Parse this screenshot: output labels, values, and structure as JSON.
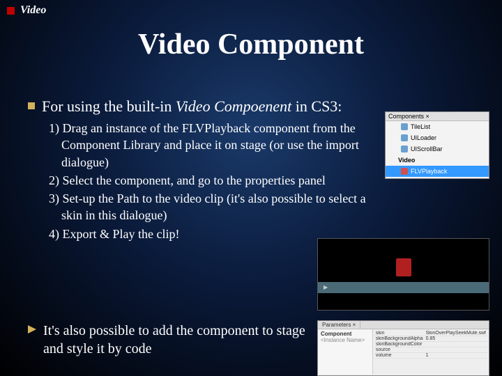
{
  "header": {
    "label": "Video"
  },
  "title": "Video Component",
  "main": {
    "text_pre": "For using the built-in ",
    "text_ital": "Video Compoenent",
    "text_post": " in CS3:"
  },
  "steps": [
    "1) Drag an instance of the FLVPlayback component from the Component Library and place it on stage (or use the import dialogue)",
    "2) Select the component, and go to the properties panel",
    "3) Set-up the Path to the video clip (it's also possible to select a skin in this dialogue)",
    "4) Export & Play the clip!"
  ],
  "footnote": "It's also possible to add the component to stage and style it by code",
  "panel_components": {
    "tab": "Components ×",
    "items": [
      {
        "label": "TileList",
        "type": "item"
      },
      {
        "label": "UILoader",
        "type": "item"
      },
      {
        "label": "UIScrollBar",
        "type": "item"
      },
      {
        "label": "Video",
        "type": "group"
      },
      {
        "label": "FLVPlayback",
        "type": "item",
        "highlight": true
      }
    ]
  },
  "panel_params": {
    "tabs": [
      "Parameters ×"
    ],
    "left": {
      "title": "Component",
      "sub": "<Instance Name>"
    },
    "rows": [
      {
        "k": "skin",
        "v": "SkinOverPlaySeekMute.swf"
      },
      {
        "k": "skinBackgroundAlpha",
        "v": "0.85"
      },
      {
        "k": "skinBackgroundColor",
        "v": ""
      },
      {
        "k": "source",
        "v": ""
      },
      {
        "k": "volume",
        "v": "1"
      }
    ]
  }
}
